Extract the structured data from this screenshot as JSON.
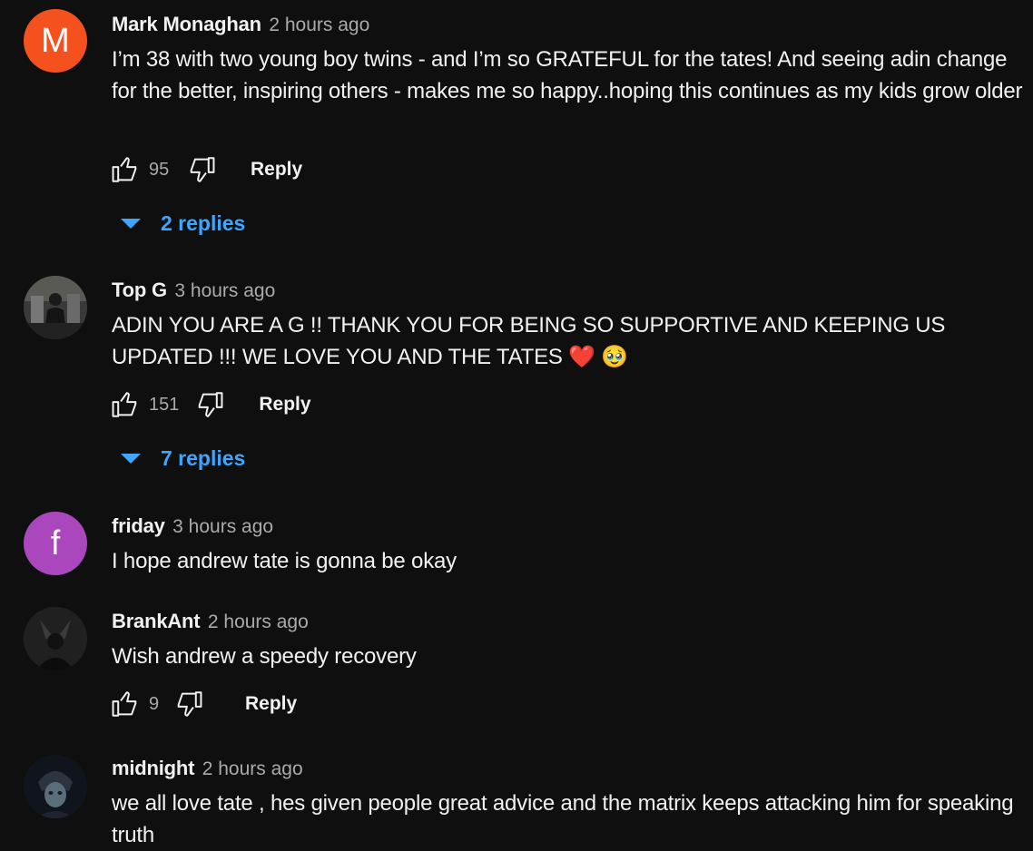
{
  "comments": [
    {
      "author": "Mark Monaghan",
      "time": "2 hours ago",
      "avatar_letter": "M",
      "avatar_color": "#f4511e",
      "text": "I’m 38 with two young boy twins - and I’m so GRATEFUL for the tates!  And seeing adin change for the better, inspiring others - makes me so happy..hoping this continues as my kids grow older",
      "likes": "95",
      "reply_label": "Reply",
      "replies_label": "2 replies"
    },
    {
      "author": "Top G",
      "time": "3 hours ago",
      "text": "ADIN YOU ARE A G !! THANK YOU FOR BEING SO SUPPORTIVE AND KEEPING US UPDATED !!! WE LOVE YOU AND THE TATES",
      "emoji_1": "❤️",
      "emoji_2": "🥹",
      "likes": "151",
      "reply_label": "Reply",
      "replies_label": "7 replies"
    },
    {
      "author": "friday",
      "time": "3 hours ago",
      "avatar_letter": "f",
      "avatar_color": "#ab47bc",
      "text": "I hope andrew tate is gonna be okay"
    },
    {
      "author": "BrankAnt",
      "time": "2 hours ago",
      "text": "Wish andrew a speedy recovery",
      "likes": "9",
      "reply_label": "Reply"
    },
    {
      "author": "midnight",
      "time": "2 hours ago",
      "text": "we all love tate , hes given people great advice and the matrix keeps attacking him for speaking truth"
    }
  ],
  "icons": {
    "like": "thumbs-up-icon",
    "dislike": "thumbs-down-icon",
    "expand": "caret-down-icon"
  },
  "colors": {
    "background": "#0f0f0f",
    "link_blue": "#3ea6ff",
    "meta_gray": "#aaaaaa"
  }
}
